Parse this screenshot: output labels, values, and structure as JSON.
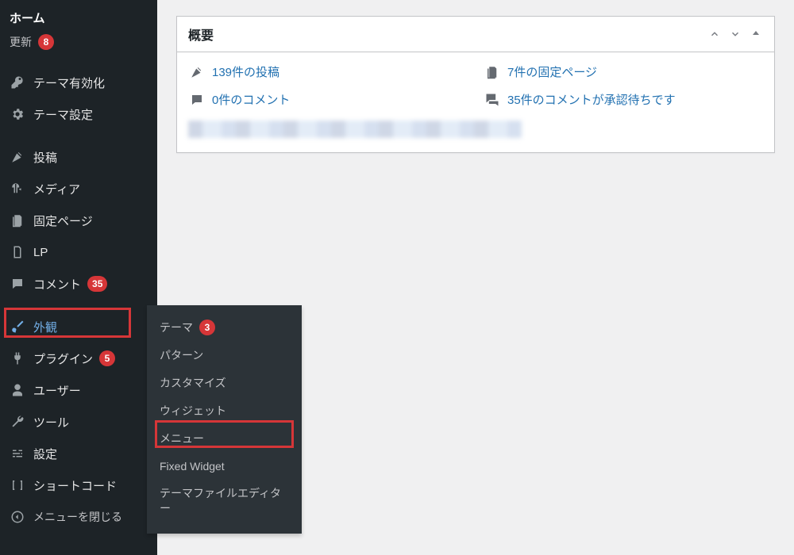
{
  "sidebar": {
    "home": "ホーム",
    "updates": {
      "label": "更新",
      "count": "8"
    },
    "theme_activation": "テーマ有効化",
    "theme_settings": "テーマ設定",
    "posts": "投稿",
    "media": "メディア",
    "pages": "固定ページ",
    "lp": "LP",
    "comments": {
      "label": "コメント",
      "count": "35"
    },
    "appearance": "外観",
    "plugins": {
      "label": "プラグイン",
      "count": "5"
    },
    "users": "ユーザー",
    "tools": "ツール",
    "settings": "設定",
    "shortcode": "ショートコード",
    "collapse": "メニューを閉じる"
  },
  "submenu": {
    "themes": {
      "label": "テーマ",
      "count": "3"
    },
    "patterns": "パターン",
    "customize": "カスタマイズ",
    "widgets": "ウィジェット",
    "menus": "メニュー",
    "fixed_widget": "Fixed Widget",
    "theme_editor": "テーマファイルエディター"
  },
  "overview": {
    "title": "概要",
    "posts": "139件の投稿",
    "pages": "7件の固定ページ",
    "comments": "0件のコメント",
    "pending": "35件のコメントが承認待ちです"
  }
}
